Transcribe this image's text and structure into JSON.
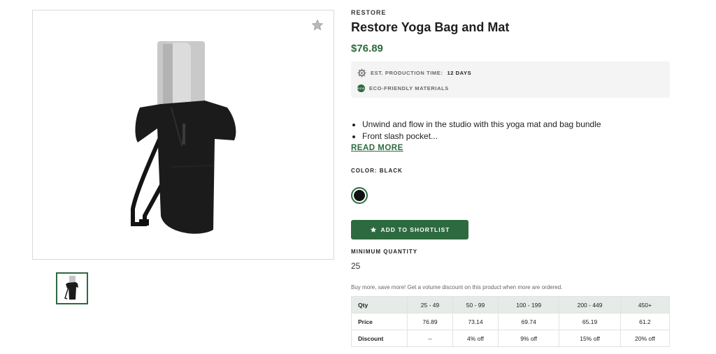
{
  "product": {
    "brand": "RESTORE",
    "title": "Restore Yoga Bag and Mat",
    "price": "$76.89",
    "favorite_icon": "star-icon"
  },
  "info": {
    "production_label": "EST. PRODUCTION TIME:",
    "production_value": "12 DAYS",
    "production_icon": "gear-icon",
    "eco_label": "ECO-FRIENDLY MATERIALS",
    "eco_badge": "ECO"
  },
  "description": {
    "bullets": [
      "Unwind and flow in the studio with this yoga mat and bag bundle",
      "Front slash pocket..."
    ],
    "read_more": "READ MORE"
  },
  "color": {
    "label": "COLOR: BLACK",
    "swatch_hex": "#111111"
  },
  "actions": {
    "shortlist_label": "ADD TO SHORTLIST",
    "shortlist_icon": "star-icon"
  },
  "minimum": {
    "label": "MINIMUM QUANTITY",
    "value": "25"
  },
  "volume": {
    "note": "Buy more, save more! Get a volume discount on this product when more are ordered.",
    "header": [
      "Qty",
      "25 - 49",
      "50 - 99",
      "100 - 199",
      "200 - 449",
      "450+"
    ],
    "price_row": [
      "Price",
      "76.89",
      "73.14",
      "69.74",
      "65.19",
      "61.2"
    ],
    "discount_row": [
      "Discount",
      "--",
      "4% off",
      "9% off",
      "15% off",
      "20% off"
    ]
  },
  "colors": {
    "accent": "#2d6a3f",
    "table_header_bg": "#e5ebe6",
    "info_bg": "#f4f4f4"
  }
}
